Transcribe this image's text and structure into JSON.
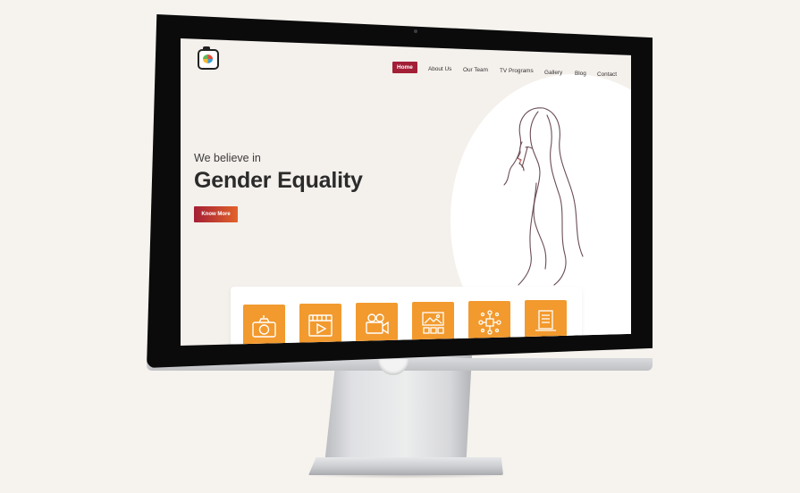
{
  "nav": {
    "items": [
      {
        "label": "Home",
        "active": true
      },
      {
        "label": "About Us"
      },
      {
        "label": "Our Team"
      },
      {
        "label": "TV Programs"
      },
      {
        "label": "Gallery"
      },
      {
        "label": "Blog"
      },
      {
        "label": "Contact"
      }
    ]
  },
  "hero": {
    "subtitle": "We believe in",
    "title": "Gender Equality",
    "cta_label": "Know More"
  },
  "services": {
    "icons": [
      "camera-icon",
      "video-player-icon",
      "video-camera-icon",
      "gallery-icon",
      "network-icon",
      "document-icon"
    ]
  },
  "colors": {
    "accent": "#a31f36",
    "accent_gradient_end": "#e2622a",
    "service_tile": "#f29a2e",
    "page_bg": "#f4f0ec"
  }
}
